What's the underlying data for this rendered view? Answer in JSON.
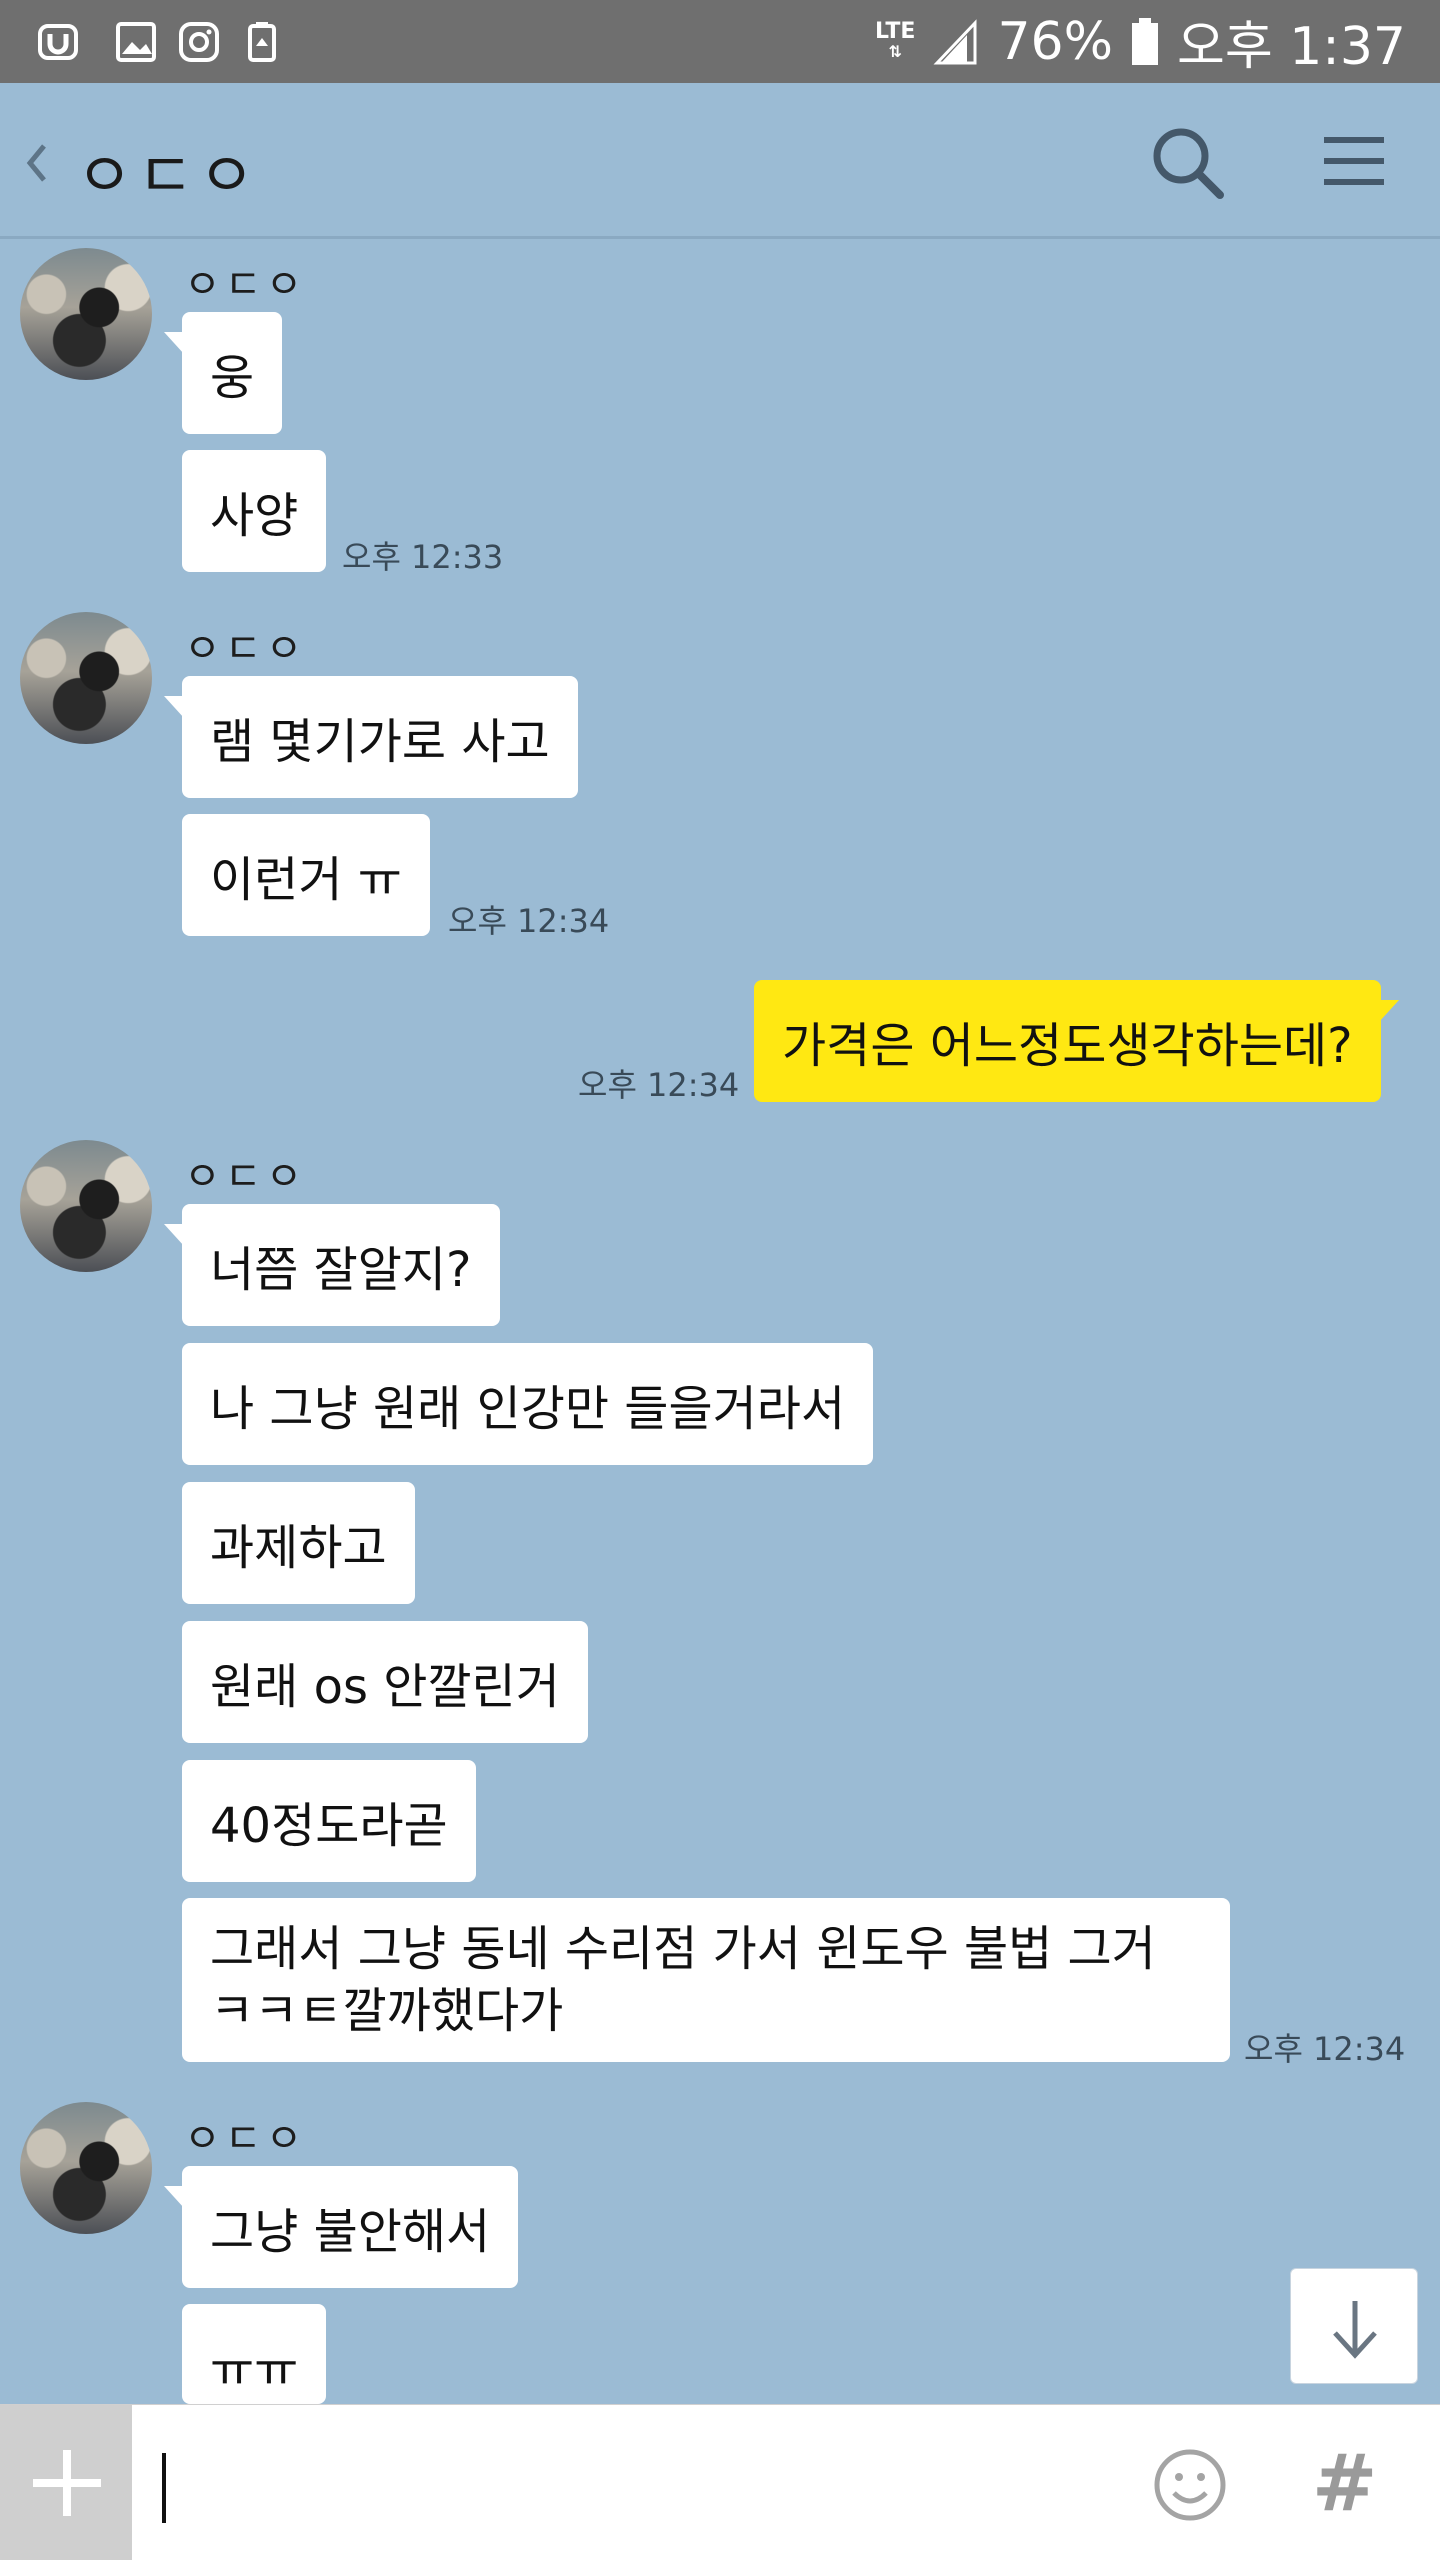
{
  "status_bar": {
    "network": "LTE",
    "battery": "76%",
    "time": "오후 1:37"
  },
  "header": {
    "title": "ㅇㄷㅇ"
  },
  "messages": [
    {
      "sender": "ㅇㄷㅇ",
      "bubbles": [
        "웅",
        "사양"
      ],
      "time": "오후 12:33"
    },
    {
      "sender": "ㅇㄷㅇ",
      "bubbles": [
        "램 몇기가로 사고",
        "이런거 ㅠ"
      ],
      "time": "오후 12:34"
    },
    {
      "mine": true,
      "text": "가격은 어느정도생각하는데?",
      "time": "오후 12:34"
    },
    {
      "sender": "ㅇㄷㅇ",
      "bubbles": [
        "너쯤 잘알지?",
        "나 그냥 원래 인강만 들을거라서",
        "과제하고",
        "원래 os 안깔린거",
        "40정도라곧",
        "그래서 그냥 동네 수리점 가서 윈도우 불법 그거 ㅋㅋㅌ깔까했다가"
      ],
      "time": "오후 12:34"
    },
    {
      "sender": "ㅇㄷㅇ",
      "bubbles": [
        "그냥 불안해서",
        "ㅠㅠ"
      ]
    }
  ],
  "input": {
    "placeholder": "",
    "hash_symbol": "#"
  },
  "colors": {
    "chat_background": "#9bbbd4",
    "my_bubble": "#ffe812",
    "other_bubble": "#ffffff",
    "status_bar": "#6f6f6f"
  },
  "icons": [
    "back-chevron-icon",
    "search-icon",
    "menu-icon",
    "plus-icon",
    "emoji-icon",
    "hash-icon",
    "arrow-down-icon"
  ]
}
